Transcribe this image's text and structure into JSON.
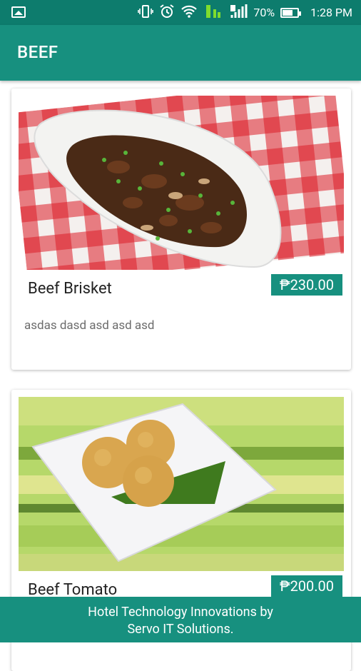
{
  "status_bar": {
    "battery": "70%",
    "time": "1:28 PM",
    "icons": [
      "image-icon",
      "vibrate-icon",
      "alarm-icon",
      "wifi-icon",
      "volte-icon",
      "signal-icon",
      "battery-icon"
    ],
    "battery_level": 0.7
  },
  "app_bar": {
    "title": "BEEF"
  },
  "items": [
    {
      "name": "Beef Brisket",
      "price": "₱230.00",
      "description": "asdas dasd asd asd asd",
      "image": "beef-brisket-stew-image"
    },
    {
      "name": "Beef Tomato",
      "price": "₱200.00",
      "description": "",
      "image": "sesame-balls-image"
    }
  ],
  "footer": {
    "line1": "Hotel Technology Innovations by",
    "line2": "Servo IT Solutions."
  },
  "colors": {
    "primary": "#17907f",
    "status_bar": "#0d7c6d"
  }
}
